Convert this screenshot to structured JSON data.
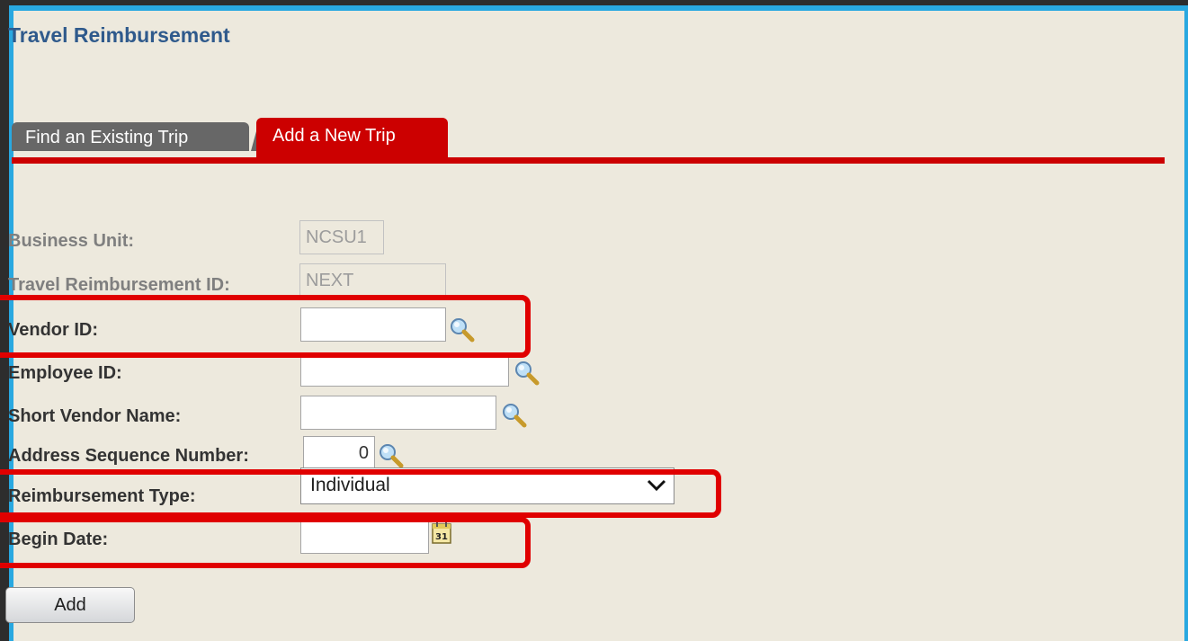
{
  "page": {
    "title": "Travel Reimbursement"
  },
  "tabs": [
    {
      "label": "Find an Existing Trip",
      "active": false
    },
    {
      "label": "Add a New Trip",
      "active": true
    }
  ],
  "form": {
    "business_unit": {
      "label": "Business Unit:",
      "value": "NCSU1"
    },
    "reimbursement_id": {
      "label": "Travel Reimbursement ID:",
      "value": "NEXT"
    },
    "vendor_id": {
      "label": "Vendor ID:",
      "value": ""
    },
    "employee_id": {
      "label": "Employee ID:",
      "value": ""
    },
    "short_vendor_name": {
      "label": "Short Vendor Name:",
      "value": ""
    },
    "address_seq": {
      "label": "Address Sequence Number:",
      "value": "0"
    },
    "reimbursement_type": {
      "label": "Reimbursement Type:",
      "selected": "Individual"
    },
    "begin_date": {
      "label": "Begin Date:",
      "value": "",
      "calendar_text": "31"
    }
  },
  "buttons": {
    "add_label": "Add"
  },
  "icons": {
    "lookup": "magnifier-icon",
    "calendar": "calendar-icon",
    "dropdown": "chevron-down-icon"
  },
  "colors": {
    "accent": "#cc0000",
    "title": "#2f5a8c",
    "frame": "#29a8e0",
    "highlight": "#e00000"
  }
}
